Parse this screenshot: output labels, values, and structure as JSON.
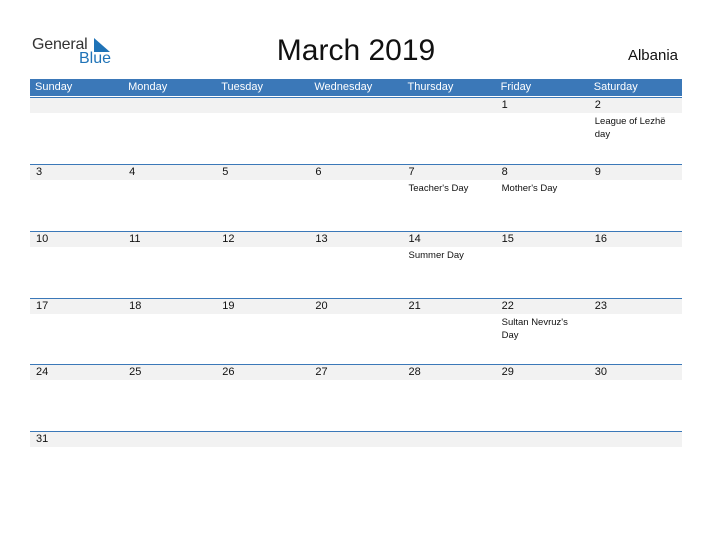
{
  "logo": {
    "word1": "General",
    "word2": "Blue"
  },
  "title": "March 2019",
  "country": "Albania",
  "weekdays": [
    "Sunday",
    "Monday",
    "Tuesday",
    "Wednesday",
    "Thursday",
    "Friday",
    "Saturday"
  ],
  "weeks": [
    [
      {
        "day": "",
        "event": ""
      },
      {
        "day": "",
        "event": ""
      },
      {
        "day": "",
        "event": ""
      },
      {
        "day": "",
        "event": ""
      },
      {
        "day": "",
        "event": ""
      },
      {
        "day": "1",
        "event": ""
      },
      {
        "day": "2",
        "event": "League of Lezhë day"
      }
    ],
    [
      {
        "day": "3",
        "event": ""
      },
      {
        "day": "4",
        "event": ""
      },
      {
        "day": "5",
        "event": ""
      },
      {
        "day": "6",
        "event": ""
      },
      {
        "day": "7",
        "event": "Teacher's Day"
      },
      {
        "day": "8",
        "event": "Mother's Day"
      },
      {
        "day": "9",
        "event": ""
      }
    ],
    [
      {
        "day": "10",
        "event": ""
      },
      {
        "day": "11",
        "event": ""
      },
      {
        "day": "12",
        "event": ""
      },
      {
        "day": "13",
        "event": ""
      },
      {
        "day": "14",
        "event": "Summer Day"
      },
      {
        "day": "15",
        "event": ""
      },
      {
        "day": "16",
        "event": ""
      }
    ],
    [
      {
        "day": "17",
        "event": ""
      },
      {
        "day": "18",
        "event": ""
      },
      {
        "day": "19",
        "event": ""
      },
      {
        "day": "20",
        "event": ""
      },
      {
        "day": "21",
        "event": ""
      },
      {
        "day": "22",
        "event": "Sultan Nevruz's Day"
      },
      {
        "day": "23",
        "event": ""
      }
    ],
    [
      {
        "day": "24",
        "event": ""
      },
      {
        "day": "25",
        "event": ""
      },
      {
        "day": "26",
        "event": ""
      },
      {
        "day": "27",
        "event": ""
      },
      {
        "day": "28",
        "event": ""
      },
      {
        "day": "29",
        "event": ""
      },
      {
        "day": "30",
        "event": ""
      }
    ],
    [
      {
        "day": "31",
        "event": ""
      },
      {
        "day": "",
        "event": ""
      },
      {
        "day": "",
        "event": ""
      },
      {
        "day": "",
        "event": ""
      },
      {
        "day": "",
        "event": ""
      },
      {
        "day": "",
        "event": ""
      },
      {
        "day": "",
        "event": ""
      }
    ]
  ]
}
